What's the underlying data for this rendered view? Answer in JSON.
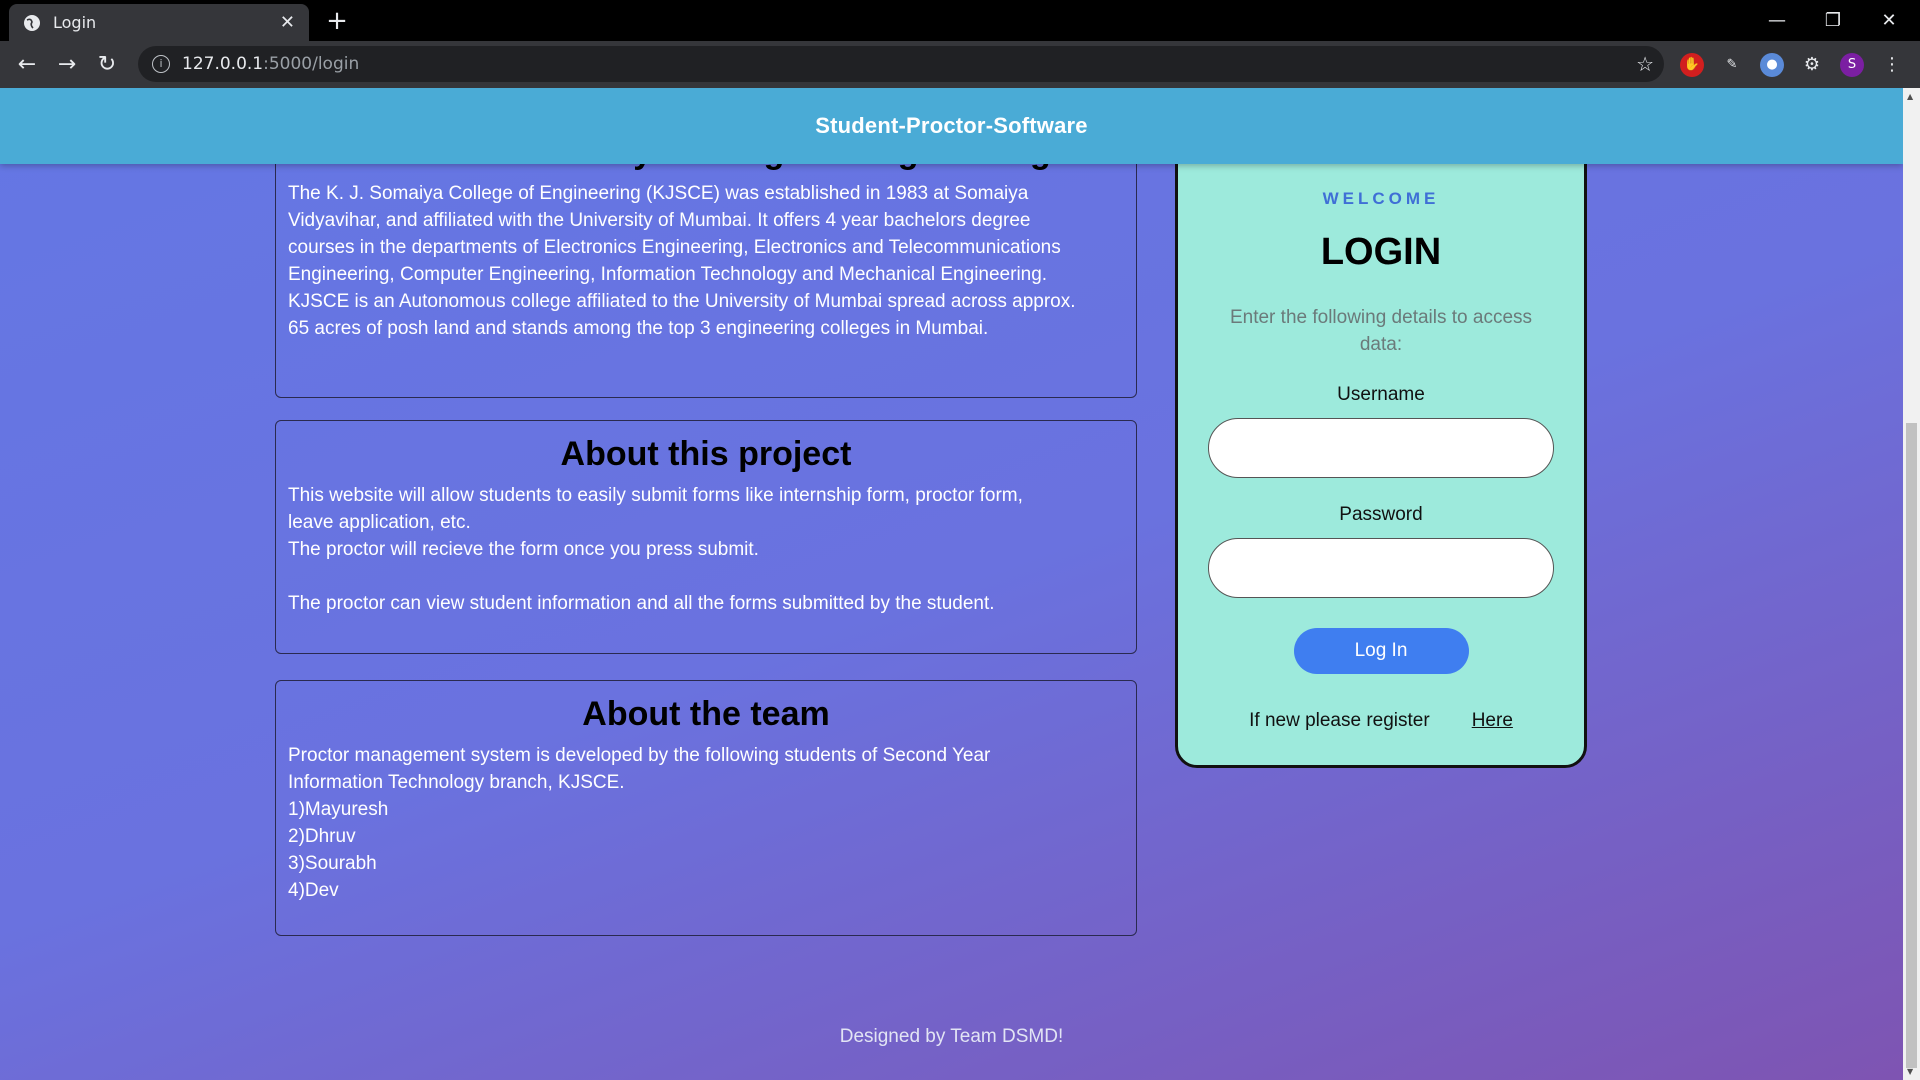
{
  "browser": {
    "tab_title": "Login",
    "tab_close": "✕",
    "new_tab": "+",
    "url_host": "127.0.0.1",
    "url_path": ":5000/login",
    "profile_initial": "S"
  },
  "header": {
    "title": "Student-Proctor-Software"
  },
  "about_college": {
    "title": "About K.J Somaiya College of Engineering",
    "lines": [
      "The K. J. Somaiya College of Engineering (KJSCE) was established in 1983 at Somaiya",
      "Vidyavihar, and affiliated with the University of Mumbai. It offers 4 year bachelors degree",
      "courses in the departments of Electronics Engineering, Electronics and Telecommunications",
      "Engineering, Computer Engineering, Information Technology and Mechanical Engineering.",
      "KJSCE is an Autonomous college affiliated to the University of Mumbai spread across approx.",
      "65 acres of posh land and stands among the top 3 engineering colleges in Mumbai."
    ]
  },
  "about_project": {
    "title": "About this project",
    "lines": [
      "This website will allow students to easily submit forms like internship form, proctor form,",
      "leave application, etc.",
      "The proctor will recieve the form once you press submit.",
      "",
      "The proctor can view student information and all the forms submitted by the student."
    ]
  },
  "about_team": {
    "title": "About the team",
    "lines": [
      "Proctor management system is developed by the following students of Second Year",
      "Information Technology branch, KJSCE.",
      "1)Mayuresh",
      "2)Dhruv",
      "3)Sourabh",
      "4)Dev"
    ]
  },
  "login": {
    "welcome": "WELCOME",
    "title": "LOGIN",
    "description": "Enter the following details to access data:",
    "username_label": "Username",
    "username_value": "",
    "password_label": "Password",
    "password_value": "",
    "button_label": "Log In",
    "register_text": "If new please register",
    "register_link": "Here"
  },
  "footer": {
    "text": "Designed by Team DSMD!"
  }
}
